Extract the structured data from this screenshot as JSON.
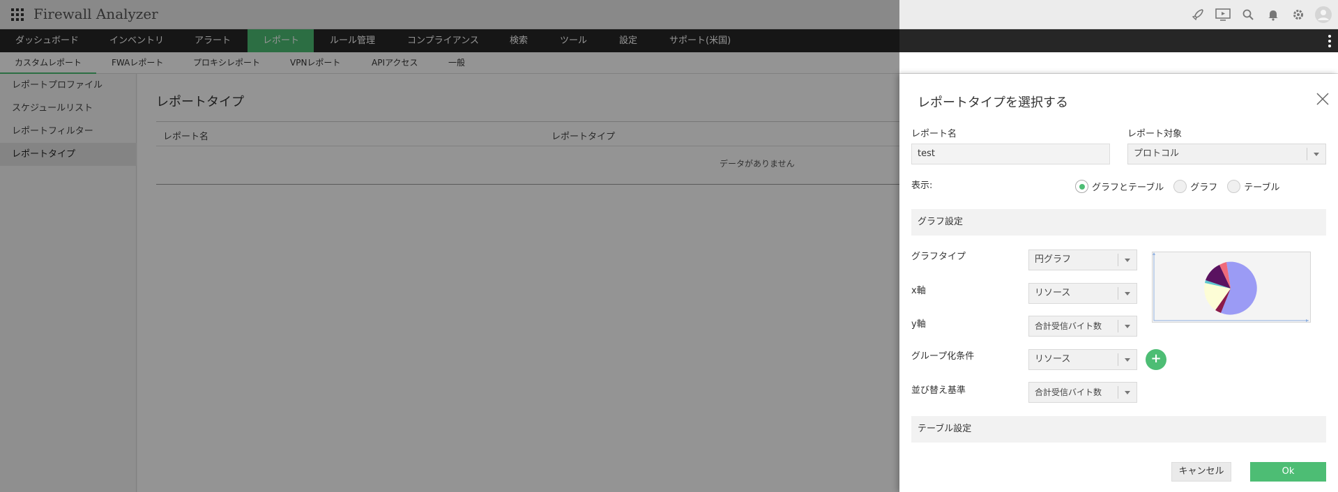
{
  "app": {
    "title": "Firewall Analyzer"
  },
  "header_icons": [
    "rocket-icon",
    "screen-play-icon",
    "search-icon",
    "bell-icon",
    "gear-icon",
    "user-avatar-icon"
  ],
  "main_nav": {
    "items": [
      {
        "label": "ダッシュボード",
        "active": false
      },
      {
        "label": "インベントリ",
        "active": false
      },
      {
        "label": "アラート",
        "active": false
      },
      {
        "label": "レポート",
        "active": true
      },
      {
        "label": "ルール管理",
        "active": false
      },
      {
        "label": "コンプライアンス",
        "active": false
      },
      {
        "label": "検索",
        "active": false
      },
      {
        "label": "ツール",
        "active": false
      },
      {
        "label": "設定",
        "active": false
      },
      {
        "label": "サポート(米国)",
        "active": false
      }
    ]
  },
  "sub_nav": {
    "items": [
      {
        "label": "カスタムレポート",
        "active": true
      },
      {
        "label": "FWAレポート",
        "active": false
      },
      {
        "label": "プロキシレポート",
        "active": false
      },
      {
        "label": "VPNレポート",
        "active": false
      },
      {
        "label": "APIアクセス",
        "active": false
      },
      {
        "label": "一般",
        "active": false
      }
    ]
  },
  "sidebar": {
    "items": [
      {
        "label": "レポートプロファイル",
        "active": false
      },
      {
        "label": "スケジュールリスト",
        "active": false
      },
      {
        "label": "レポートフィルター",
        "active": false
      },
      {
        "label": "レポートタイプ",
        "active": true
      }
    ]
  },
  "content": {
    "title": "レポートタイプ",
    "columns": [
      "レポート名",
      "レポートタイプ"
    ],
    "empty_message": "データがありません"
  },
  "panel": {
    "title": "レポートタイプを選択する",
    "report_name_label": "レポート名",
    "report_name_value": "test",
    "report_target_label": "レポート対象",
    "report_target_value": "プロトコル",
    "display_label": "表示:",
    "display_options": [
      {
        "label": "グラフとテーブル",
        "selected": true
      },
      {
        "label": "グラフ",
        "selected": false
      },
      {
        "label": "テーブル",
        "selected": false
      }
    ],
    "graph_section_label": "グラフ設定",
    "graph_type_label": "グラフタイプ",
    "graph_type_value": "円グラフ",
    "x_axis_label": "x軸",
    "x_axis_value": "リソース",
    "y_axis_label": "y軸",
    "y_axis_value": "合計受信バイト数",
    "group_by_label": "グループ化条件",
    "group_by_value": "リソース",
    "sort_by_label": "並び替え基準",
    "sort_by_value": "合計受信バイト数",
    "table_section_label": "テーブル設定",
    "cancel_label": "キャンセル",
    "ok_label": "Ok"
  },
  "colors": {
    "accent": "#4dbd74",
    "nav_bg": "#262626",
    "pie_slices": [
      "#9b9bf5",
      "#8b1a4a",
      "#fdfdd6",
      "#5ec6d0",
      "#5a1260",
      "#f06a7a"
    ]
  }
}
